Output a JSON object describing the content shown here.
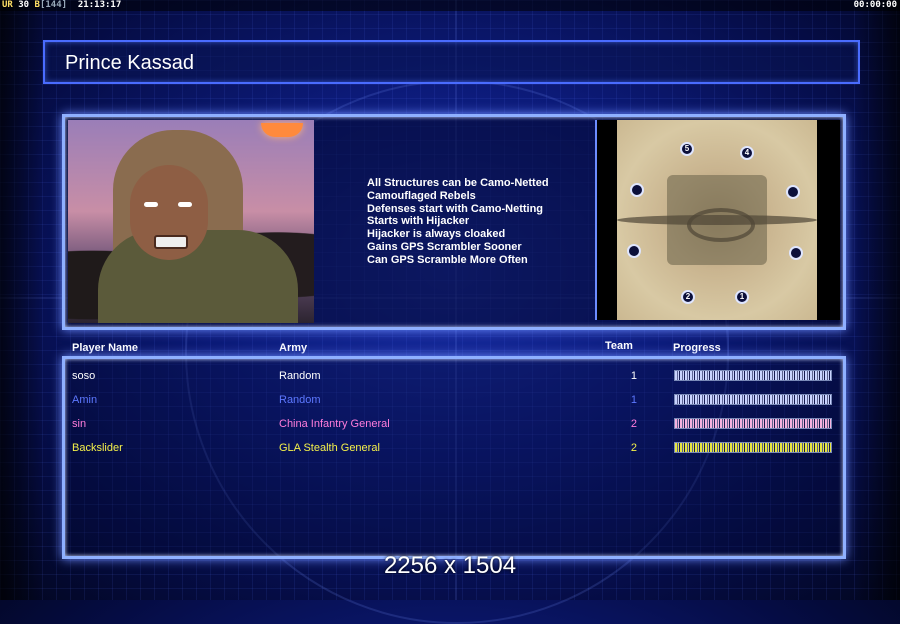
{
  "hud": {
    "ur_label": "UR",
    "fps": "30",
    "b_label": "B",
    "b_value": "[144]",
    "clock": "21:13:17",
    "timer": "00:00:00"
  },
  "header": {
    "title": "Prince Kassad"
  },
  "traits": [
    "All Structures can be Camo-Netted",
    "Camouflaged Rebels",
    "Defenses start with Camo-Netting",
    "Starts with Hijacker",
    "Hijacker is always cloaked",
    "Gains GPS Scrambler Sooner",
    "Can GPS Scramble More Often"
  ],
  "minimap": {
    "spawns": [
      "5",
      "4",
      "",
      "",
      "",
      "",
      "2",
      "1"
    ]
  },
  "table": {
    "headers": {
      "player": "Player Name",
      "army": "Army",
      "team": "Team",
      "progress": "Progress"
    },
    "rows": [
      {
        "player": "soso",
        "army": "Random",
        "team": "1",
        "progress": 1.0,
        "color": "#ffffff",
        "bar_color": "#c9d3ff"
      },
      {
        "player": "Amin",
        "army": "Random",
        "team": "1",
        "progress": 1.0,
        "color": "#5d78ff",
        "bar_color": "#c9d3ff"
      },
      {
        "player": "sin",
        "army": "China Infantry General",
        "team": "2",
        "progress": 1.0,
        "color": "#ff7ddc",
        "bar_color": "#f6b2e0"
      },
      {
        "player": "Backslider",
        "army": "GLA Stealth General",
        "team": "2",
        "progress": 1.0,
        "color": "#f4f04a",
        "bar_color": "#e6e640"
      }
    ]
  },
  "overlay": {
    "resolution": "2256 x 1504"
  }
}
